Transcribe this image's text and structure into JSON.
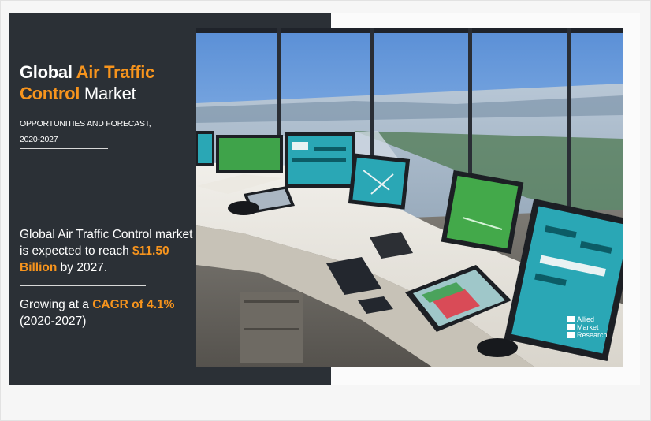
{
  "headline": {
    "prefix": "Global ",
    "accent": "Air Traffic Control",
    "suffix": " Market"
  },
  "subtitle": {
    "line1": "OPPORTUNITIES AND FORECAST,",
    "line2": "2020-2027"
  },
  "lead": {
    "text": "Global Air Traffic Control market is expected to reach ",
    "value": "$11.50 Billion",
    "tail": " by 2027."
  },
  "growth": {
    "prefix": "Growing at a ",
    "cagr": "CAGR of 4.1%",
    "period": "(2020-2027)"
  },
  "logo": {
    "line1": "Allied",
    "line2": "Market",
    "line3": "Research"
  },
  "colors": {
    "accent": "#f7941d",
    "panel": "#2b3036"
  }
}
